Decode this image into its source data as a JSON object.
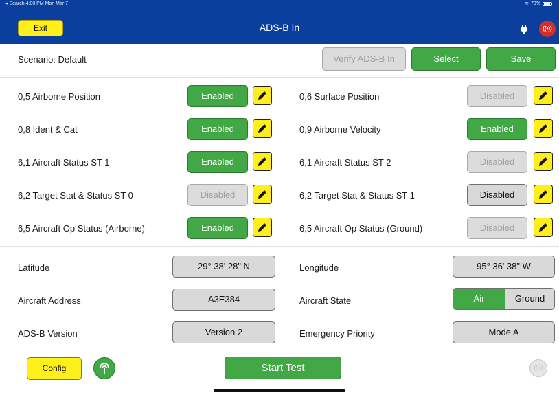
{
  "status_bar": {
    "left": "◂ Search  4:00 PM  Mon Mar 7",
    "battery": "73%"
  },
  "nav": {
    "exit_label": "Exit",
    "title": "ADS-B In",
    "icons": [
      "plug-icon",
      "antenna-alert-icon"
    ]
  },
  "scenario": {
    "label": "Scenario: Default",
    "verify_label": "Verify ADS-B In",
    "select_label": "Select",
    "save_label": "Save"
  },
  "messages": [
    {
      "label": "0,5 Airborne Position",
      "state": "Enabled"
    },
    {
      "label": "0,6 Surface Position",
      "state": "Disabled"
    },
    {
      "label": "0,8 Ident & Cat",
      "state": "Enabled"
    },
    {
      "label": "0,9 Airborne Velocity",
      "state": "Enabled"
    },
    {
      "label": "6,1 Aircraft Status ST 1",
      "state": "Enabled"
    },
    {
      "label": "6,1 Aircraft Status ST 2",
      "state": "Disabled"
    },
    {
      "label": "6,2 Target Stat & Status ST 0",
      "state": "Disabled"
    },
    {
      "label": "6,2 Target Stat & Status ST 1",
      "state": "Disabled"
    },
    {
      "label": "6,5 Aircraft Op Status (Airborne)",
      "state": "Enabled"
    },
    {
      "label": "6,5 Aircraft Op Status (Ground)",
      "state": "Disabled"
    }
  ],
  "params": {
    "latitude_label": "Latitude",
    "latitude_value": "29° 38' 28\" N",
    "longitude_label": "Longitude",
    "longitude_value": "95° 36' 38\" W",
    "address_label": "Aircraft Address",
    "address_value": "A3E384",
    "state_label": "Aircraft State",
    "state_air": "Air",
    "state_ground": "Ground",
    "version_label": "ADS-B Version",
    "version_value": "Version 2",
    "emergency_label": "Emergency Priority",
    "emergency_value": "Mode A"
  },
  "footer": {
    "config_label": "Config",
    "start_label": "Start Test"
  },
  "colors": {
    "nav_blue": "#0a3f9e",
    "enabled_green": "#41a845",
    "edit_yellow": "#ffee1a",
    "alert_red": "#d42d2a"
  }
}
